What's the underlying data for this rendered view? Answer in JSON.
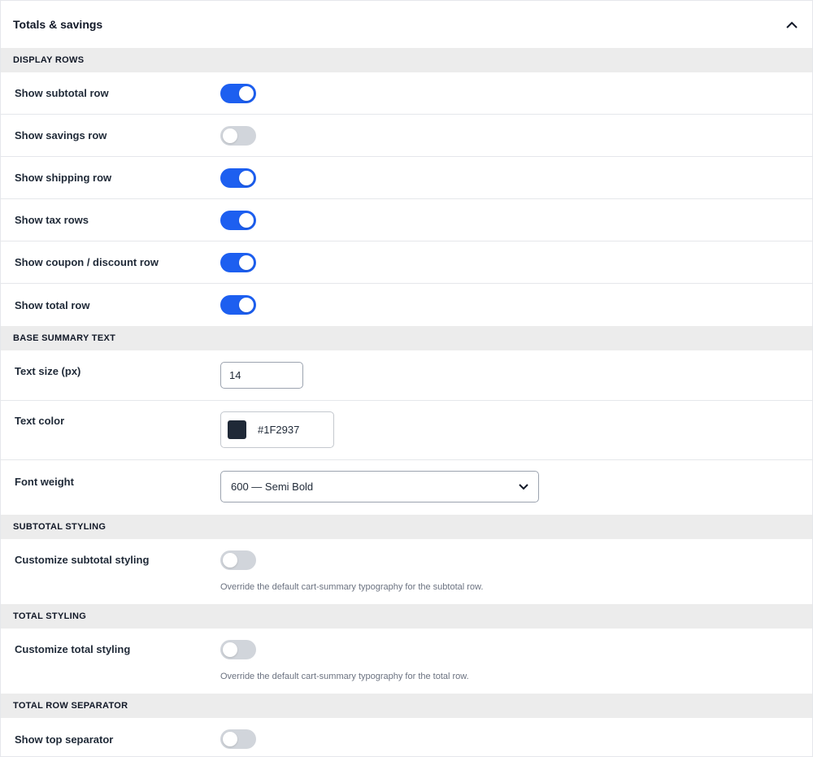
{
  "panel": {
    "title": "Totals & savings",
    "collapse_icon": "chevron-up-icon"
  },
  "sections": {
    "display_rows": {
      "title": "DISPLAY ROWS",
      "rows": [
        {
          "label": "Show subtotal row",
          "enabled": true
        },
        {
          "label": "Show savings row",
          "enabled": false
        },
        {
          "label": "Show shipping row",
          "enabled": true
        },
        {
          "label": "Show tax rows",
          "enabled": true
        },
        {
          "label": "Show coupon / discount row",
          "enabled": true
        },
        {
          "label": "Show total row",
          "enabled": true
        }
      ]
    },
    "base_summary_text": {
      "title": "BASE SUMMARY TEXT",
      "text_size": {
        "label": "Text size (px)",
        "value": "14"
      },
      "text_color": {
        "label": "Text color",
        "value": "#1F2937",
        "swatch": "#1f2937"
      },
      "font_weight": {
        "label": "Font weight",
        "selected": "600 — Semi Bold",
        "icon": "chevron-down-icon"
      }
    },
    "subtotal_styling": {
      "title": "SUBTOTAL STYLING",
      "label": "Customize subtotal styling",
      "enabled": false,
      "help": "Override the default cart-summary typography for the subtotal row."
    },
    "total_styling": {
      "title": "TOTAL STYLING",
      "label": "Customize total styling",
      "enabled": false,
      "help": "Override the default cart-summary typography for the total row."
    },
    "total_row_separator": {
      "title": "TOTAL ROW SEPARATOR",
      "label": "Show top separator",
      "enabled": false
    }
  },
  "colors": {
    "toggle_on": "#1d5ff0",
    "toggle_off": "#d1d5db",
    "section_bg": "#ececec"
  }
}
